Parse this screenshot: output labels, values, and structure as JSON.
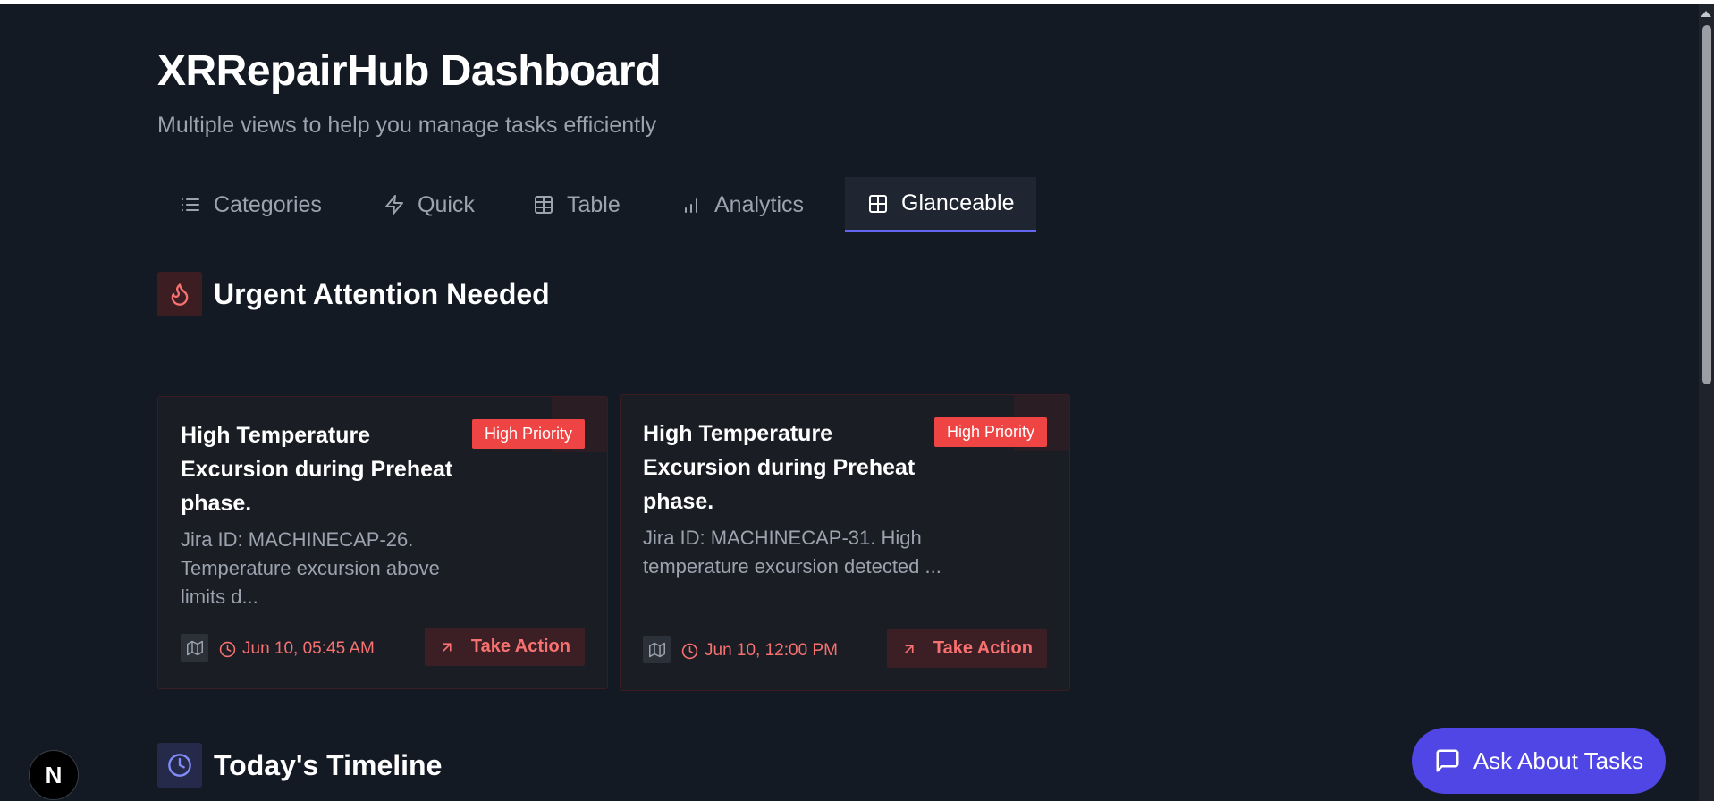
{
  "header": {
    "title": "XRRepairHub Dashboard",
    "subtitle": "Multiple views to help you manage tasks efficiently"
  },
  "tabs": [
    {
      "label": "Categories",
      "icon": "list-icon"
    },
    {
      "label": "Quick",
      "icon": "zap-icon"
    },
    {
      "label": "Table",
      "icon": "table-icon"
    },
    {
      "label": "Analytics",
      "icon": "bar-chart-icon"
    },
    {
      "label": "Glanceable",
      "icon": "grid-icon",
      "active": true
    }
  ],
  "urgent": {
    "title": "Urgent Attention Needed",
    "icon": "flame-icon",
    "accent": "#ef4444",
    "cards": [
      {
        "title": "High Temperature Excursion during Preheat phase.",
        "badge": "High Priority",
        "description": "Jira ID: MACHINECAP-26. Temperature excursion above limits d...",
        "time": "Jun 10, 05:45 AM",
        "action": "Take Action"
      },
      {
        "title": "High Temperature Excursion during Preheat phase.",
        "badge": "High Priority",
        "description": "Jira ID: MACHINECAP-31. High temperature excursion detected ...",
        "time": "Jun 10, 12:00 PM",
        "action": "Take Action"
      }
    ]
  },
  "timeline": {
    "title": "Today's Timeline",
    "icon": "clock-icon",
    "accent": "#818cf8"
  },
  "chat": {
    "label": "Ask About Tasks",
    "icon": "message-square-icon",
    "color": "#4f46e5"
  },
  "devtools": {
    "label": "N"
  }
}
